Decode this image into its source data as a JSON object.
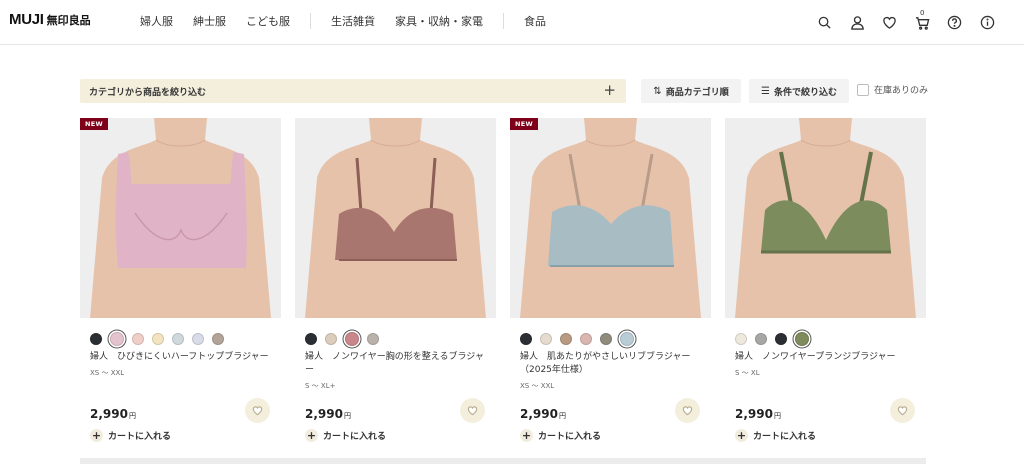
{
  "header": {
    "logo_latin": "MUJI",
    "logo_kanji": "無印良品",
    "nav": [
      "婦人服",
      "紳士服",
      "こども服",
      "生活雑貨",
      "家具・収納・家電",
      "食品"
    ],
    "icons": [
      "search-icon",
      "account-icon",
      "favorite-heart-icon",
      "cart-icon",
      "help-icon",
      "info-icon"
    ],
    "cart_count": "0"
  },
  "toolbar": {
    "filter_label": "カテゴリから商品を絞り込む",
    "filter_plus": "+",
    "sort_label": "商品カテゴリ順",
    "sort_icon": "⇅",
    "condition_label": "条件で絞り込む",
    "condition_icon": "☰",
    "stock_label": "在庫ありのみ"
  },
  "products": [
    {
      "badge": "NEW",
      "colors": [
        "#2b2f33",
        "#e4c3cf",
        "#f0cfc8",
        "#f2e4c0",
        "#cfd9dc",
        "#d9dbe8",
        "#b3a49a"
      ],
      "selected_color": 1,
      "name": "婦人　ひびきにくいハーフトップブラジャー",
      "size": "XS 〜 XXL",
      "price": "2,990",
      "yen": "円",
      "cart_label": "カートに入れる",
      "bra_color": "#e0b4c6",
      "bra_shadow": "#c997ab",
      "style": "halftop"
    },
    {
      "badge": "",
      "colors": [
        "#2b2f33",
        "#dcccbc",
        "#c9878c",
        "#b9b2aa"
      ],
      "selected_color": 2,
      "name": "婦人　ノンワイヤー胸の形を整えるブラジャー",
      "size": "S 〜 XL+",
      "price": "2,990",
      "yen": "円",
      "cart_label": "カートに入れる",
      "bra_color": "#a9766f",
      "bra_shadow": "#8c5e58",
      "style": "wire"
    },
    {
      "badge": "NEW",
      "colors": [
        "#2b2f33",
        "#e5dbcf",
        "#b89a82",
        "#d9b7b0",
        "#8f8c7e",
        "#b9cdd6"
      ],
      "selected_color": 5,
      "name": "婦人　肌あたりがやさしいリブブラジャー（2025年仕様）",
      "size": "XS 〜 XXL",
      "price": "2,990",
      "yen": "円",
      "cart_label": "カートに入れる",
      "bra_color": "#a8bcc3",
      "bra_shadow": "#8aa0a8",
      "style": "rib"
    },
    {
      "badge": "",
      "colors": [
        "#eee9dd",
        "#a7a7a5",
        "#2b2f33",
        "#7f8b5d"
      ],
      "selected_color": 3,
      "name": "婦人　ノンワイヤープランジブラジャー",
      "size": "S 〜 XL",
      "price": "2,990",
      "yen": "円",
      "cart_label": "カートに入れる",
      "bra_color": "#7d8c5d",
      "bra_shadow": "#65734a",
      "style": "plunge"
    }
  ]
}
